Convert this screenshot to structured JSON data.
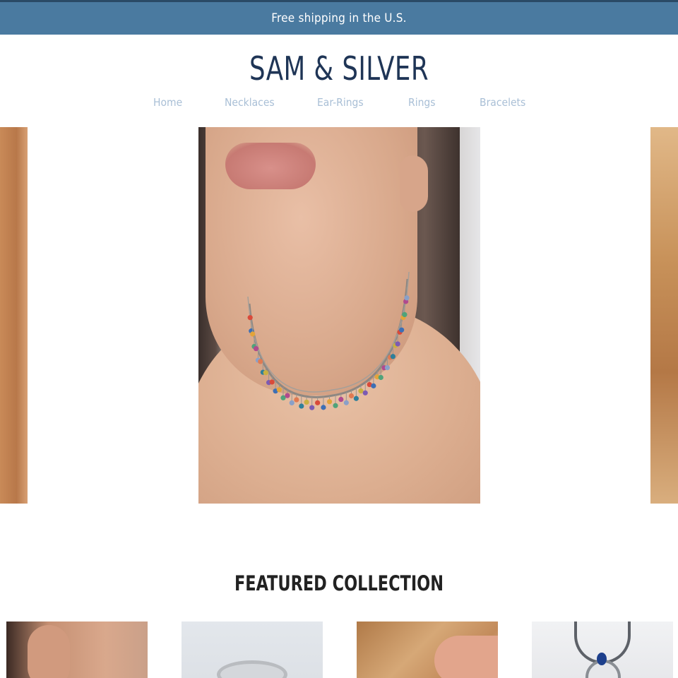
{
  "announcement": {
    "text": "Free shipping in the U.S."
  },
  "brand": {
    "logo_text": "SAM & SILVER"
  },
  "nav": {
    "items": [
      {
        "label": "Home"
      },
      {
        "label": "Necklaces"
      },
      {
        "label": "Ear-Rings"
      },
      {
        "label": "Rings"
      },
      {
        "label": "Bracelets"
      }
    ]
  },
  "featured": {
    "title": "FEATURED COLLECTION"
  },
  "colors": {
    "announcement_bg": "#4a7aa0",
    "logo": "#1f3556",
    "nav_text": "#a9bfd6",
    "heading": "#222222"
  }
}
